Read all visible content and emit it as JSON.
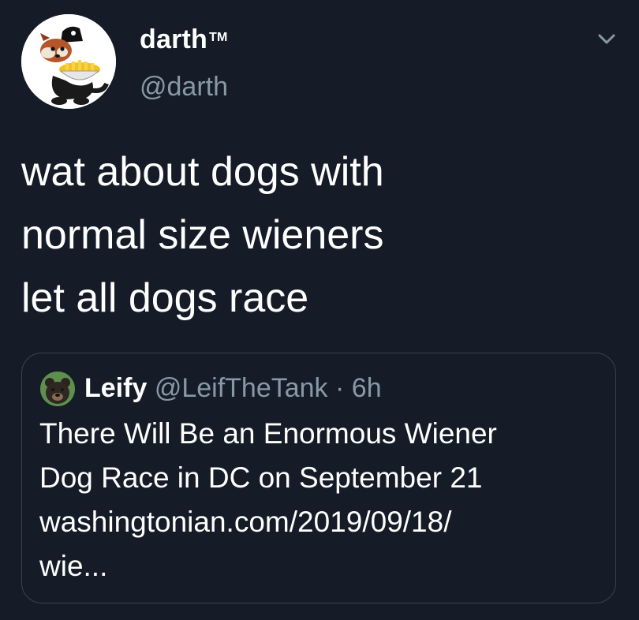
{
  "author": {
    "display_name": "darth",
    "trademark": "TM",
    "handle": "@darth",
    "avatar_icon": "red-panda-with-fries-avatar"
  },
  "menu": {
    "icon": "chevron-down-icon"
  },
  "tweet": {
    "lines": [
      "wat about dogs with",
      "normal size wieners",
      "let all dogs race"
    ]
  },
  "quoted_tweet": {
    "display_name": "Leify",
    "handle": "@LeifTheTank",
    "separator": "·",
    "time": "6h",
    "avatar_icon": "bear-avatar",
    "body_lines": [
      "There Will Be an Enormous Wiener",
      "Dog Race in DC on September 21",
      "washingtonian.com/2019/09/18/",
      "wie..."
    ]
  },
  "colors": {
    "background": "#151c27",
    "text_primary": "#ffffff",
    "text_secondary": "#8899a6",
    "border": "#38444d"
  }
}
